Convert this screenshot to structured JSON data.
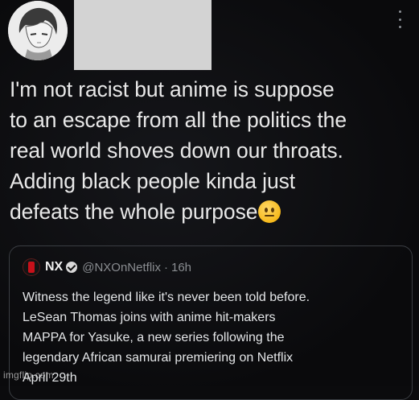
{
  "tweet": {
    "author_avatar_icon": "anime-character-avatar",
    "author_name_redacted": true,
    "more_icon": "more-options-icon",
    "text": "I'm not racist but anime is suppose\nto an escape from all the politics the\nreal world shoves down our throats.\nAdding black people kinda just\ndefeats the whole purpose",
    "emoji": "neutral-face-emoji"
  },
  "quoted_tweet": {
    "avatar_icon": "netflix-logo-icon",
    "name": "NX",
    "verified_icon": "verified-badge-icon",
    "handle": "@NXOnNetflix",
    "separator": "·",
    "time": "16h",
    "body": "Witness the legend like it's never been told before.\nLeSean Thomas joins with anime hit-makers\nMAPPA for Yasuke, a new series following the\nlegendary African samurai premiering on Netflix\nApril 29th"
  },
  "watermark": "imgflip.com",
  "colors": {
    "background": "#0b0b0d",
    "text": "#e8e8e8",
    "muted": "#8a8d91",
    "card_border": "#3a3d42",
    "redaction": "#d3d3d3"
  }
}
